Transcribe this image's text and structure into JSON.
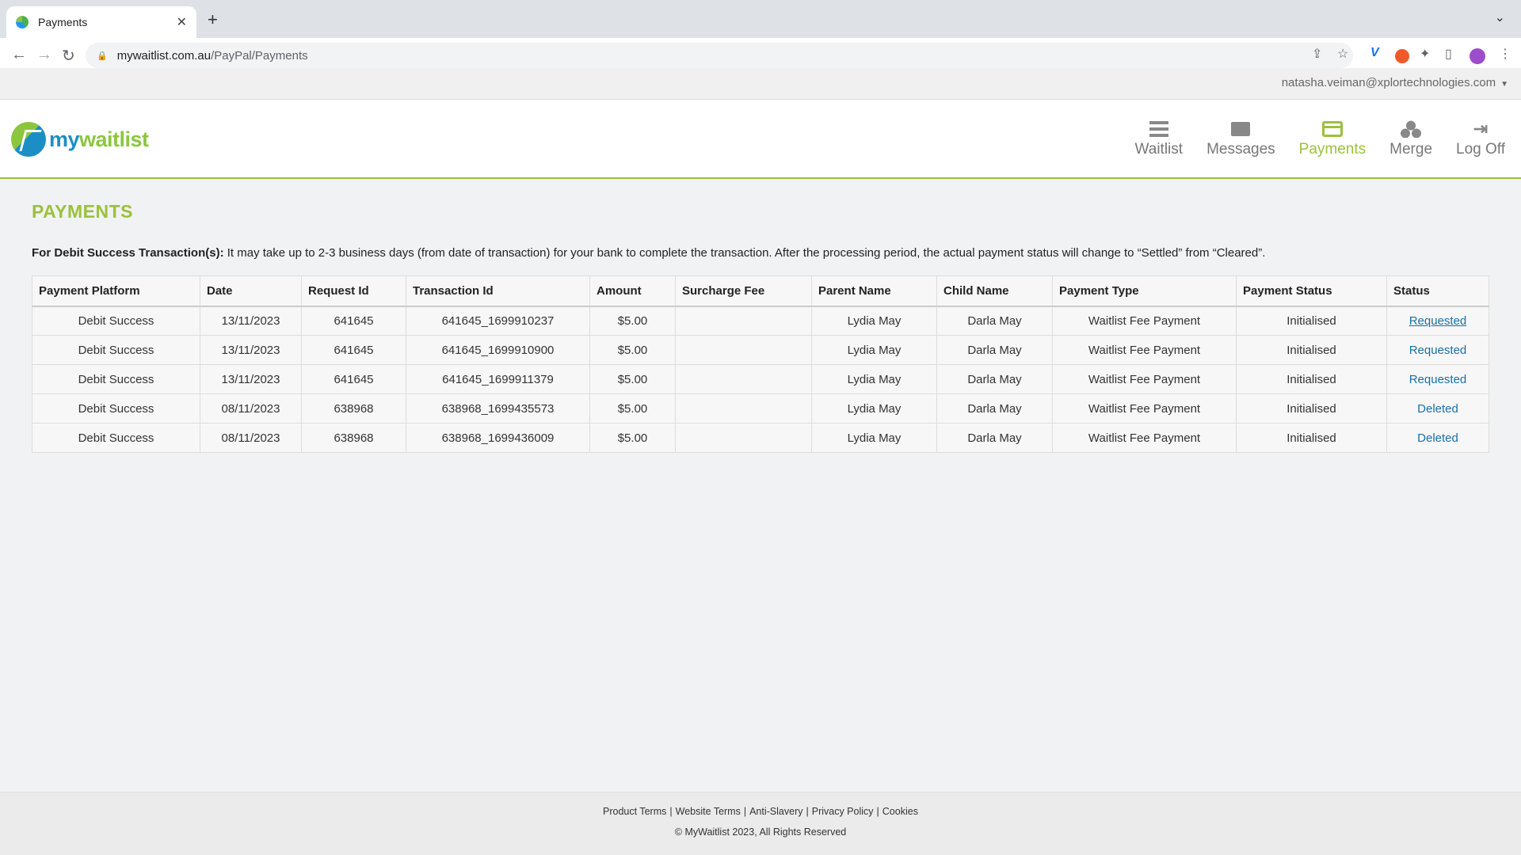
{
  "browser": {
    "tab_title": "Payments",
    "tab_close": "✕",
    "new_tab": "+",
    "tab_menu": "⌄",
    "url_host": "mywaitlist.com.au",
    "url_path": "/PayPal/Payments"
  },
  "user": {
    "email": "natasha.veiman@xplortechnologies.com"
  },
  "logo": {
    "part1": "my",
    "part2": "waitlist"
  },
  "nav": [
    {
      "label": "Waitlist",
      "icon": "list-icon"
    },
    {
      "label": "Messages",
      "icon": "envelope-icon"
    },
    {
      "label": "Payments",
      "icon": "credit-card-icon",
      "active": true
    },
    {
      "label": "Merge",
      "icon": "cubes-icon"
    },
    {
      "label": "Log Off",
      "icon": "sign-out-icon"
    }
  ],
  "page": {
    "title": "PAYMENTS",
    "notice_bold": "For Debit Success Transaction(s):",
    "notice_text": " It may take up to 2-3 business days (from date of transaction) for your bank to complete the transaction. After the processing period, the actual payment status will change to “Settled” from “Cleared”."
  },
  "table": {
    "headers": [
      "Payment Platform",
      "Date",
      "Request Id",
      "Transaction Id",
      "Amount",
      "Surcharge Fee",
      "Parent Name",
      "Child Name",
      "Payment Type",
      "Payment Status",
      "Status"
    ],
    "rows": [
      [
        "Debit Success",
        "13/11/2023",
        "641645",
        "641645_1699910237",
        "$5.00",
        "",
        "Lydia May",
        "Darla May",
        "Waitlist Fee Payment",
        "Initialised",
        "Requested"
      ],
      [
        "Debit Success",
        "13/11/2023",
        "641645",
        "641645_1699910900",
        "$5.00",
        "",
        "Lydia May",
        "Darla May",
        "Waitlist Fee Payment",
        "Initialised",
        "Requested"
      ],
      [
        "Debit Success",
        "13/11/2023",
        "641645",
        "641645_1699911379",
        "$5.00",
        "",
        "Lydia May",
        "Darla May",
        "Waitlist Fee Payment",
        "Initialised",
        "Requested"
      ],
      [
        "Debit Success",
        "08/11/2023",
        "638968",
        "638968_1699435573",
        "$5.00",
        "",
        "Lydia May",
        "Darla May",
        "Waitlist Fee Payment",
        "Initialised",
        "Deleted"
      ],
      [
        "Debit Success",
        "08/11/2023",
        "638968",
        "638968_1699436009",
        "$5.00",
        "",
        "Lydia May",
        "Darla May",
        "Waitlist Fee Payment",
        "Initialised",
        "Deleted"
      ]
    ]
  },
  "footer": {
    "links": [
      "Product Terms",
      "Website Terms",
      "Anti-Slavery",
      "Privacy Policy",
      "Cookies"
    ],
    "separator": "|",
    "copyright": "© MyWaitlist 2023, All Rights Reserved"
  },
  "colors": {
    "accent": "#9bc13c",
    "link": "#1b6fa8",
    "logo_blue": "#1b8fc5"
  }
}
